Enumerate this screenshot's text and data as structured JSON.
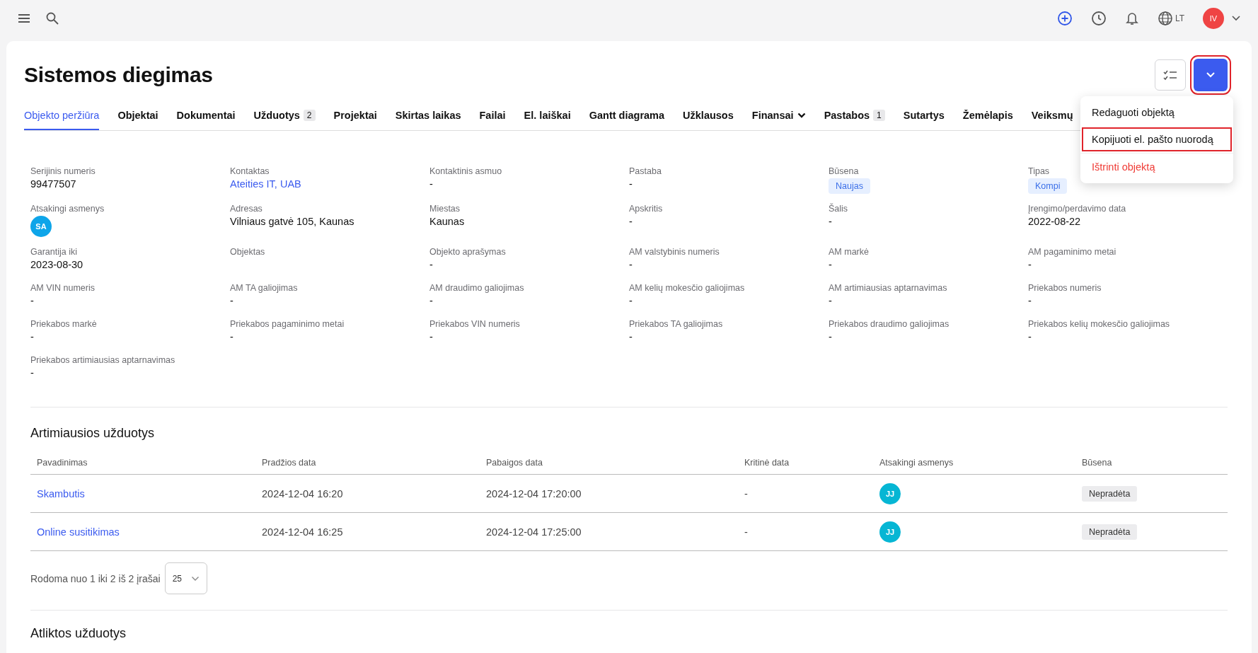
{
  "topbar": {
    "language": "LT",
    "user": {
      "initials": "IV",
      "color": "#ef4444"
    }
  },
  "title": "Sistemos diegimas",
  "actions": {
    "primary_highlighted": true,
    "menu_open": true,
    "menu": [
      {
        "label": "Redaguoti objektą",
        "kind": "normal",
        "highlighted": false
      },
      {
        "label": "Kopijuoti el. pašto nuorodą",
        "kind": "normal",
        "highlighted": true
      },
      {
        "label": "Ištrinti objektą",
        "kind": "danger",
        "highlighted": false
      }
    ]
  },
  "tabs": [
    {
      "label": "Objekto peržiūra",
      "selected": true
    },
    {
      "label": "Objektai",
      "selected": false
    },
    {
      "label": "Dokumentai",
      "selected": false
    },
    {
      "label": "Užduotys",
      "count": "2",
      "selected": false
    },
    {
      "label": "Projektai",
      "selected": false
    },
    {
      "label": "Skirtas laikas",
      "selected": false
    },
    {
      "label": "Failai",
      "selected": false
    },
    {
      "label": "El. laiškai",
      "selected": false
    },
    {
      "label": "Gantt diagrama",
      "selected": false
    },
    {
      "label": "Užklausos",
      "selected": false
    },
    {
      "label": "Finansai",
      "dropdown": true,
      "selected": false
    },
    {
      "label": "Pastabos",
      "count": "1",
      "selected": false
    },
    {
      "label": "Sutartys",
      "selected": false
    },
    {
      "label": "Žemėlapis",
      "selected": false
    },
    {
      "label": "Veiksmų",
      "selected": false
    }
  ],
  "fields": [
    {
      "label": "Serijinis numeris",
      "kind": "text",
      "value": "99477507"
    },
    {
      "label": "Kontaktas",
      "kind": "link",
      "value": "Ateities IT, UAB"
    },
    {
      "label": "Kontaktinis asmuo",
      "kind": "text",
      "value": "-"
    },
    {
      "label": "Pastaba",
      "kind": "text",
      "value": "-"
    },
    {
      "label": "Būsena",
      "kind": "badge",
      "value": "Naujas"
    },
    {
      "label": "Tipas",
      "kind": "badge",
      "value": "Kompi"
    },
    {
      "label": "Atsakingi asmenys",
      "kind": "avatar",
      "value": "SA",
      "color": "#0ea5e9"
    },
    {
      "label": "Adresas",
      "kind": "text",
      "value": "Vilniaus gatvė 105, Kaunas"
    },
    {
      "label": "Miestas",
      "kind": "text",
      "value": "Kaunas"
    },
    {
      "label": "Apskritis",
      "kind": "text",
      "value": "-"
    },
    {
      "label": "Šalis",
      "kind": "text",
      "value": "-"
    },
    {
      "label": "Įrengimo/perdavimo data",
      "kind": "text",
      "value": "2022-08-22"
    },
    {
      "label": "Garantija iki",
      "kind": "text",
      "value": "2023-08-30"
    },
    {
      "label": "Objektas"
    },
    {
      "label": "Objekto aprašymas",
      "kind": "text",
      "value": "-"
    },
    {
      "label": "AM valstybinis numeris",
      "kind": "text",
      "value": "-"
    },
    {
      "label": "AM markė",
      "kind": "text",
      "value": "-"
    },
    {
      "label": "AM pagaminimo metai",
      "kind": "text",
      "value": "-"
    },
    {
      "label": "AM VIN numeris",
      "kind": "text",
      "value": "-"
    },
    {
      "label": "AM TA galiojimas",
      "kind": "text",
      "value": "-"
    },
    {
      "label": "AM draudimo galiojimas",
      "kind": "text",
      "value": "-"
    },
    {
      "label": "AM kelių mokesčio galiojimas",
      "kind": "text",
      "value": "-"
    },
    {
      "label": "AM artimiausias aptarnavimas",
      "kind": "text",
      "value": "-"
    },
    {
      "label": "Priekabos numeris",
      "kind": "text",
      "value": "-"
    },
    {
      "label": "Priekabos markė",
      "kind": "text",
      "value": "-"
    },
    {
      "label": "Priekabos pagaminimo metai",
      "kind": "text",
      "value": "-"
    },
    {
      "label": "Priekabos VIN numeris",
      "kind": "text",
      "value": "-"
    },
    {
      "label": "Priekabos TA galiojimas",
      "kind": "text",
      "value": "-"
    },
    {
      "label": "Priekabos draudimo galiojimas",
      "kind": "text",
      "value": "-"
    },
    {
      "label": "Priekabos kelių mokesčio galiojimas",
      "kind": "text",
      "value": "-"
    },
    {
      "label": "Priekabos artimiausias aptarnavimas",
      "kind": "text",
      "value": "-"
    }
  ],
  "upcoming_tasks": {
    "title": "Artimiausios užduotys",
    "columns": [
      "Pavadinimas",
      "Pradžios data",
      "Pabaigos data",
      "Kritinė data",
      "Atsakingi asmenys",
      "Būsena"
    ],
    "rows": [
      {
        "name": "Skambutis",
        "start": "2024-12-04 16:20",
        "end": "2024-12-04 17:20:00",
        "critical": "-",
        "assignee": {
          "initials": "JJ",
          "color": "#06b6d4"
        },
        "status": "Nepradėta"
      },
      {
        "name": "Online susitikimas",
        "start": "2024-12-04 16:25",
        "end": "2024-12-04 17:25:00",
        "critical": "-",
        "assignee": {
          "initials": "JJ",
          "color": "#06b6d4"
        },
        "status": "Nepradėta"
      }
    ],
    "summary": "Rodoma nuo 1 iki 2 iš 2 įrašai",
    "page_size": "25"
  },
  "done_tasks": {
    "title": "Atliktos užduotys"
  }
}
